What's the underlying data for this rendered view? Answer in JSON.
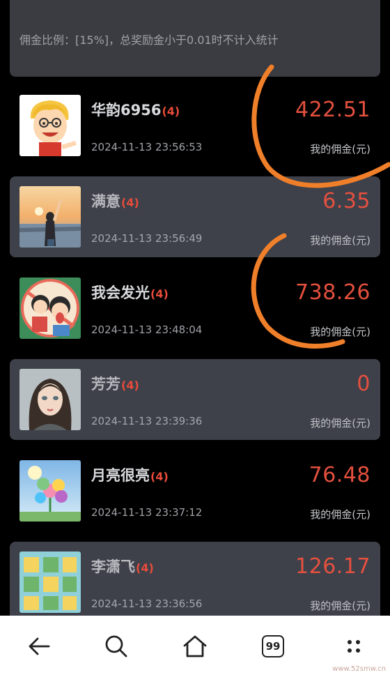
{
  "banner": {
    "text": "佣金比例：[15%]，总奖励金小于0.01时不计入统计"
  },
  "records": [
    {
      "name": "华韵6956",
      "level": "(4)",
      "time": "2024-11-13 23:56:53",
      "amount": "422.51",
      "label": "我的佣金(元)",
      "avatar": "cartoon-boy"
    },
    {
      "name": "满意",
      "level": "(4)",
      "time": "2024-11-13 23:56:49",
      "amount": "6.35",
      "label": "我的佣金(元)",
      "avatar": "sunset-girl"
    },
    {
      "name": "我会发光",
      "level": "(4)",
      "time": "2024-11-13 23:48:04",
      "amount": "738.26",
      "label": "我的佣金(元)",
      "avatar": "cartoon-couple"
    },
    {
      "name": "芳芳",
      "level": "(4)",
      "time": "2024-11-13 23:39:36",
      "amount": "0",
      "label": "我的佣金(元)",
      "avatar": "portrait-girl"
    },
    {
      "name": "月亮很亮",
      "level": "(4)",
      "time": "2024-11-13 23:37:12",
      "amount": "76.48",
      "label": "我的佣金(元)",
      "avatar": "flower-sky"
    },
    {
      "name": "李潇飞",
      "level": "(4)",
      "time": "2024-11-13 23:36:56",
      "amount": "126.17",
      "label": "我的佣金(元)",
      "avatar": "game-tiles"
    }
  ],
  "bottom_nav": {
    "items": [
      {
        "icon": "back-arrow-icon"
      },
      {
        "icon": "search-icon"
      },
      {
        "icon": "home-icon"
      },
      {
        "icon": "tabs-count-icon",
        "count": "99"
      },
      {
        "icon": "more-menu-icon"
      }
    ]
  },
  "watermark": {
    "url": "www.52smw.cn"
  },
  "colors": {
    "background": "#000000",
    "card": "#3e414a",
    "amount": "#e4503e",
    "annotation": "#f07f2a"
  }
}
